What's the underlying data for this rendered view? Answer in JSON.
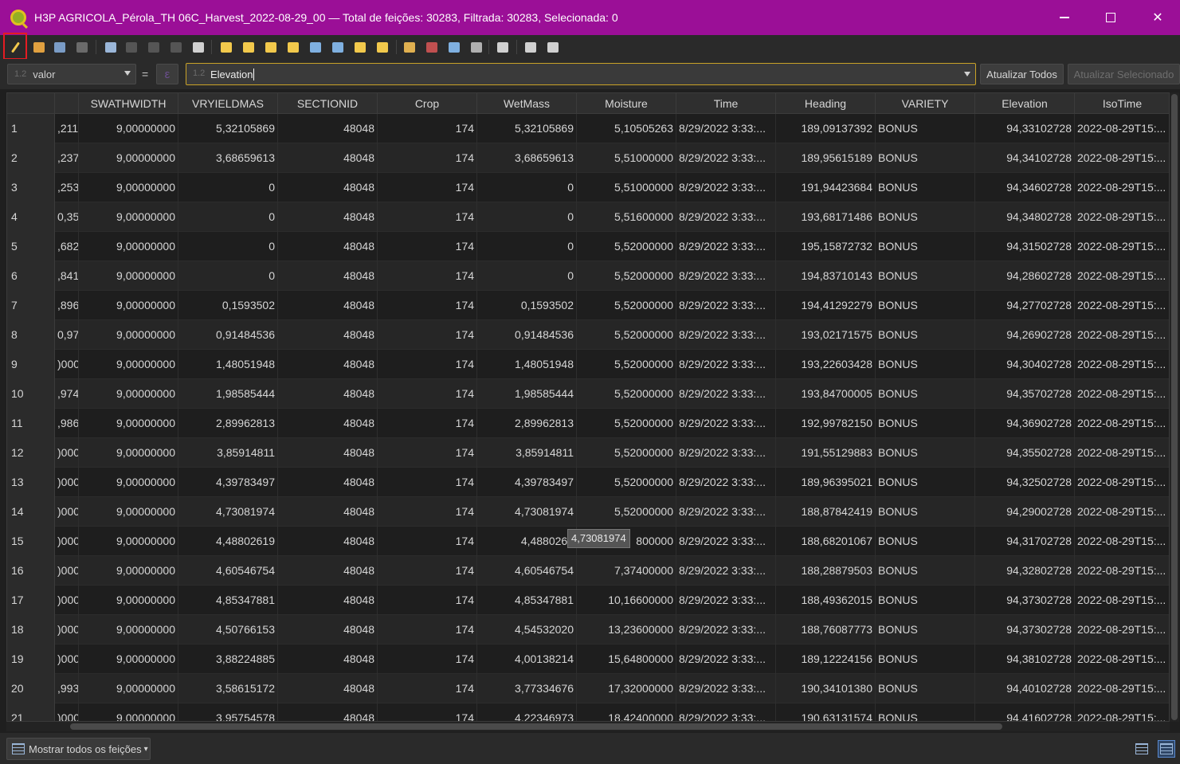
{
  "window": {
    "title": "H3P AGRICOLA_Pérola_TH 06C_Harvest_2022-08-29_00 — Total de feições: 30283, Filtrada: 30283, Selecionada: 0",
    "app_icon": "qgis-icon",
    "controls": {
      "minimize": "—",
      "close": "✕"
    }
  },
  "toolbar": {
    "buttons": [
      {
        "name": "toggle-editing-icon",
        "color": "#f2c94c"
      },
      {
        "name": "multi-edit-icon",
        "color": "#e0a040"
      },
      {
        "name": "save-edits-icon",
        "color": "#7a9cc6"
      },
      {
        "name": "reload-icon",
        "color": "#6a6a6a"
      },
      {
        "name": "add-feature-icon",
        "color": "#9ab6d8"
      },
      {
        "name": "delete-feature-icon",
        "color": "#555555"
      },
      {
        "name": "cut-icon",
        "color": "#555555"
      },
      {
        "name": "copy-icon",
        "color": "#555555"
      },
      {
        "name": "paste-icon",
        "color": "#d0d0d0"
      },
      {
        "name": "select-expression-icon",
        "color": "#f2c94c"
      },
      {
        "name": "select-all-icon",
        "color": "#f2c94c"
      },
      {
        "name": "invert-selection-icon",
        "color": "#f2c94c"
      },
      {
        "name": "deselect-all-icon",
        "color": "#f2c94c"
      },
      {
        "name": "filter-icon",
        "color": "#7fb0e0"
      },
      {
        "name": "move-selection-top-icon",
        "color": "#7fb0e0"
      },
      {
        "name": "pan-to-selected-icon",
        "color": "#f2c94c"
      },
      {
        "name": "zoom-to-selected-icon",
        "color": "#f2c94c"
      },
      {
        "name": "new-field-icon",
        "color": "#e0b050"
      },
      {
        "name": "delete-field-icon",
        "color": "#c05050"
      },
      {
        "name": "field-calculator-icon",
        "color": "#7fb0e0"
      },
      {
        "name": "conditional-formatting-icon",
        "color": "#b0b0b0"
      },
      {
        "name": "actions-icon",
        "color": "#d0d0d0"
      },
      {
        "name": "dock-table-icon",
        "color": "#d0d0d0"
      },
      {
        "name": "zoom-map-icon",
        "color": "#d0d0d0"
      }
    ]
  },
  "expression_bar": {
    "field_combo": "valor",
    "equals": "=",
    "expression_value": "Elevation",
    "update_all_label": "Atualizar Todos",
    "update_selected_label": "Atualizar Selecionado"
  },
  "table": {
    "columns": [
      "SWATHWIDTH",
      "VRYIELDMAS",
      "SECTIONID",
      "Crop",
      "WetMass",
      "Moisture",
      "Time",
      "Heading",
      "VARIETY",
      "Elevation",
      "IsoTime"
    ],
    "rows": [
      {
        "idx": "1",
        "p": ",211",
        "c": [
          "9,00000000",
          "5,32105869",
          "48048",
          "174",
          "5,32105869",
          "5,10505263",
          "8/29/2022 3:33:...",
          "189,09137392",
          "BONUS",
          "94,33102728",
          "2022-08-29T15:..."
        ]
      },
      {
        "idx": "2",
        "p": ",237",
        "c": [
          "9,00000000",
          "3,68659613",
          "48048",
          "174",
          "3,68659613",
          "5,51000000",
          "8/29/2022 3:33:...",
          "189,95615189",
          "BONUS",
          "94,34102728",
          "2022-08-29T15:..."
        ]
      },
      {
        "idx": "3",
        "p": ",253",
        "c": [
          "9,00000000",
          "0",
          "48048",
          "174",
          "0",
          "5,51000000",
          "8/29/2022 3:33:...",
          "191,94423684",
          "BONUS",
          "94,34602728",
          "2022-08-29T15:..."
        ]
      },
      {
        "idx": "4",
        "p": "0,35",
        "c": [
          "9,00000000",
          "0",
          "48048",
          "174",
          "0",
          "5,51600000",
          "8/29/2022 3:33:...",
          "193,68171486",
          "BONUS",
          "94,34802728",
          "2022-08-29T15:..."
        ]
      },
      {
        "idx": "5",
        "p": ",682",
        "c": [
          "9,00000000",
          "0",
          "48048",
          "174",
          "0",
          "5,52000000",
          "8/29/2022 3:33:...",
          "195,15872732",
          "BONUS",
          "94,31502728",
          "2022-08-29T15:..."
        ]
      },
      {
        "idx": "6",
        "p": ",841",
        "c": [
          "9,00000000",
          "0",
          "48048",
          "174",
          "0",
          "5,52000000",
          "8/29/2022 3:33:...",
          "194,83710143",
          "BONUS",
          "94,28602728",
          "2022-08-29T15:..."
        ]
      },
      {
        "idx": "7",
        "p": ",896",
        "c": [
          "9,00000000",
          "0,1593502",
          "48048",
          "174",
          "0,1593502",
          "5,52000000",
          "8/29/2022 3:33:...",
          "194,41292279",
          "BONUS",
          "94,27702728",
          "2022-08-29T15:..."
        ]
      },
      {
        "idx": "8",
        "p": "0,97",
        "c": [
          "9,00000000",
          "0,91484536",
          "48048",
          "174",
          "0,91484536",
          "5,52000000",
          "8/29/2022 3:33:...",
          "193,02171575",
          "BONUS",
          "94,26902728",
          "2022-08-29T15:..."
        ]
      },
      {
        "idx": "9",
        "p": ")000",
        "c": [
          "9,00000000",
          "1,48051948",
          "48048",
          "174",
          "1,48051948",
          "5,52000000",
          "8/29/2022 3:33:...",
          "193,22603428",
          "BONUS",
          "94,30402728",
          "2022-08-29T15:..."
        ]
      },
      {
        "idx": "10",
        "p": ",974",
        "c": [
          "9,00000000",
          "1,98585444",
          "48048",
          "174",
          "1,98585444",
          "5,52000000",
          "8/29/2022 3:33:...",
          "193,84700005",
          "BONUS",
          "94,35702728",
          "2022-08-29T15:..."
        ]
      },
      {
        "idx": "11",
        "p": ",986",
        "c": [
          "9,00000000",
          "2,89962813",
          "48048",
          "174",
          "2,89962813",
          "5,52000000",
          "8/29/2022 3:33:...",
          "192,99782150",
          "BONUS",
          "94,36902728",
          "2022-08-29T15:..."
        ]
      },
      {
        "idx": "12",
        "p": ")000",
        "c": [
          "9,00000000",
          "3,85914811",
          "48048",
          "174",
          "3,85914811",
          "5,52000000",
          "8/29/2022 3:33:...",
          "191,55129883",
          "BONUS",
          "94,35502728",
          "2022-08-29T15:..."
        ]
      },
      {
        "idx": "13",
        "p": ")000",
        "c": [
          "9,00000000",
          "4,39783497",
          "48048",
          "174",
          "4,39783497",
          "5,52000000",
          "8/29/2022 3:33:...",
          "189,96395021",
          "BONUS",
          "94,32502728",
          "2022-08-29T15:..."
        ]
      },
      {
        "idx": "14",
        "p": ")000",
        "c": [
          "9,00000000",
          "4,73081974",
          "48048",
          "174",
          "4,73081974",
          "5,52000000",
          "8/29/2022 3:33:...",
          "188,87842419",
          "BONUS",
          "94,29002728",
          "2022-08-29T15:..."
        ]
      },
      {
        "idx": "15",
        "p": ")000",
        "c": [
          "9,00000000",
          "4,48802619",
          "48048",
          "174",
          "4,4880261",
          "800000",
          "8/29/2022 3:33:...",
          "188,68201067",
          "BONUS",
          "94,31702728",
          "2022-08-29T15:..."
        ]
      },
      {
        "idx": "16",
        "p": ")000",
        "c": [
          "9,00000000",
          "4,60546754",
          "48048",
          "174",
          "4,60546754",
          "7,37400000",
          "8/29/2022 3:33:...",
          "188,28879503",
          "BONUS",
          "94,32802728",
          "2022-08-29T15:..."
        ]
      },
      {
        "idx": "17",
        "p": ")000",
        "c": [
          "9,00000000",
          "4,85347881",
          "48048",
          "174",
          "4,85347881",
          "10,16600000",
          "8/29/2022 3:33:...",
          "188,49362015",
          "BONUS",
          "94,37302728",
          "2022-08-29T15:..."
        ]
      },
      {
        "idx": "18",
        "p": ")000",
        "c": [
          "9,00000000",
          "4,50766153",
          "48048",
          "174",
          "4,54532020",
          "13,23600000",
          "8/29/2022 3:33:...",
          "188,76087773",
          "BONUS",
          "94,37302728",
          "2022-08-29T15:..."
        ]
      },
      {
        "idx": "19",
        "p": ")000",
        "c": [
          "9,00000000",
          "3,88224885",
          "48048",
          "174",
          "4,00138214",
          "15,64800000",
          "8/29/2022 3:33:...",
          "189,12224156",
          "BONUS",
          "94,38102728",
          "2022-08-29T15:..."
        ]
      },
      {
        "idx": "20",
        "p": ",993",
        "c": [
          "9,00000000",
          "3,58615172",
          "48048",
          "174",
          "3,77334676",
          "17,32000000",
          "8/29/2022 3:33:...",
          "190,34101380",
          "BONUS",
          "94,40102728",
          "2022-08-29T15:..."
        ]
      },
      {
        "idx": "21",
        "p": ")000",
        "c": [
          "9,00000000",
          "3,95754578",
          "48048",
          "174",
          "4,22346973",
          "18,42400000",
          "8/29/2022 3:33:...",
          "190,63131574",
          "BONUS",
          "94,41602728",
          "2022-08-29T15:..."
        ]
      }
    ],
    "tooltip": "4,73081974"
  },
  "status": {
    "filter_label": "Mostrar todos os feições",
    "filter_caret": "▾"
  },
  "colors": {
    "titlebar": "#9b0f97",
    "highlight": "#e51c23",
    "expr_border": "#c9a227"
  }
}
